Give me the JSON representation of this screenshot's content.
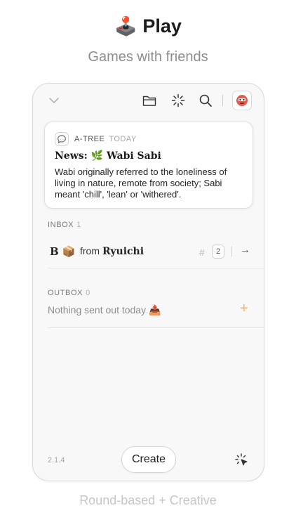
{
  "hero": {
    "icon": "joystick-icon",
    "emoji": "🕹️",
    "title": "Play",
    "subtitle": "Games with friends"
  },
  "toolbar": {
    "icons": [
      "chevron-down-icon",
      "folder-icon",
      "loading-spinner-icon",
      "search-icon",
      "avatar"
    ]
  },
  "news": {
    "icon": "speech-bubble-icon",
    "source": "A-TREE",
    "time": "TODAY",
    "title": "News: 🌿 Wabi Sabi",
    "body": "Wabi originally referred to the loneliness of living in nature, remote from society; Sabi meant 'chill', 'lean' or 'withered'."
  },
  "inbox": {
    "label": "INBOX",
    "count": "1",
    "items": [
      {
        "game": "B 📦",
        "from_label": "from",
        "from_name": "Ryuichi",
        "turn_count": "2"
      }
    ]
  },
  "outbox": {
    "label": "OUTBOX",
    "count": "0",
    "empty_text": "Nothing sent out today 📤"
  },
  "footer_bar": {
    "version": "2.1.4",
    "create_label": "Create"
  },
  "caption": "Round-based + Creative",
  "colors": {
    "accent_plus": "#f0b46a",
    "avatar_red": "#d9534f",
    "text_muted": "#8e8e8e"
  }
}
